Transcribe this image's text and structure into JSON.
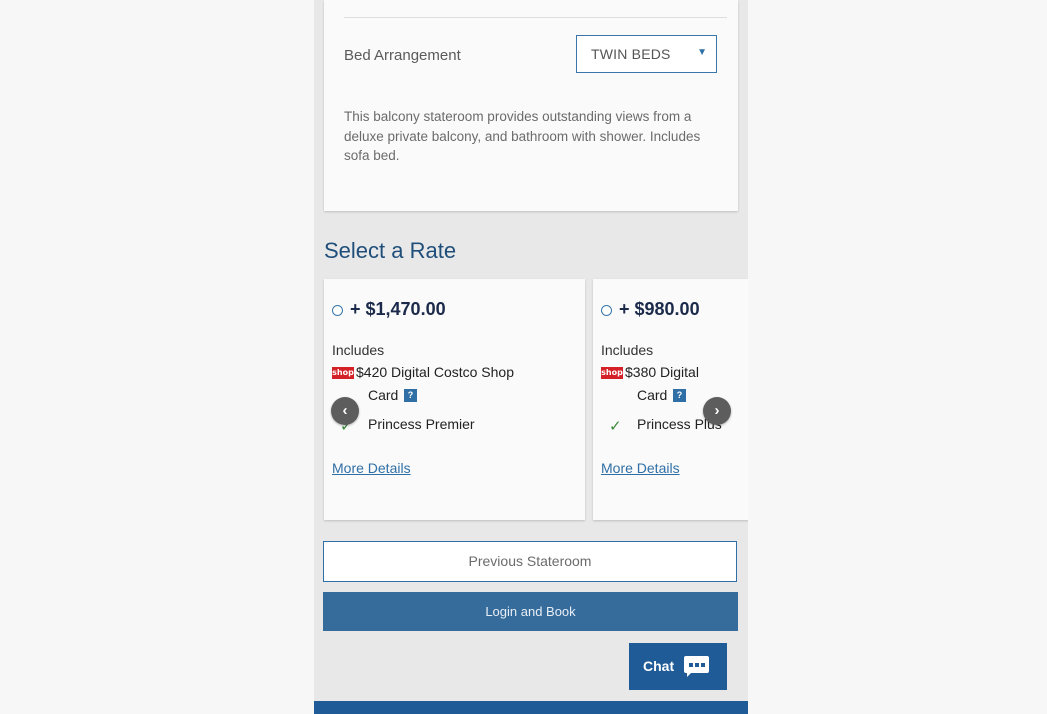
{
  "stateroom": {
    "bed_arrangement_label": "Bed Arrangement",
    "bed_arrangement_value": "TWIN BEDS",
    "description": "This balcony stateroom provides outstanding views from a deluxe private balcony, and bathroom with shower. Includes sofa bed."
  },
  "rates": {
    "heading": "Select a Rate",
    "items": [
      {
        "price": "+ $1,470.00",
        "includes_label": "Includes",
        "shop_logo_text": "shop",
        "card_line1": "$420 Digital Costco Shop",
        "card_line2": "Card",
        "help": "?",
        "perk": "Princess Premier",
        "more_details": "More Details"
      },
      {
        "price": "+ $980.00",
        "includes_label": "Includes",
        "shop_logo_text": "shop",
        "card_line1": "$380 Digital",
        "card_line2": "Card",
        "help": "?",
        "perk": "Princess Plus",
        "more_details": "More Details"
      }
    ]
  },
  "buttons": {
    "previous_stateroom": "Previous Stateroom",
    "login_and_book": "Login and Book",
    "chat": "Chat"
  },
  "colors": {
    "primary_blue": "#356c9c",
    "heading_blue": "#1f4e7a",
    "chat_blue": "#1f5b96",
    "shop_red": "#d42027",
    "check_green": "#3a8a3a"
  },
  "icons": {
    "dropdown": "caret-down-icon",
    "prev": "chevron-left-icon",
    "next": "chevron-right-icon",
    "check": "check-icon",
    "chat": "chat-bubble-icon"
  }
}
